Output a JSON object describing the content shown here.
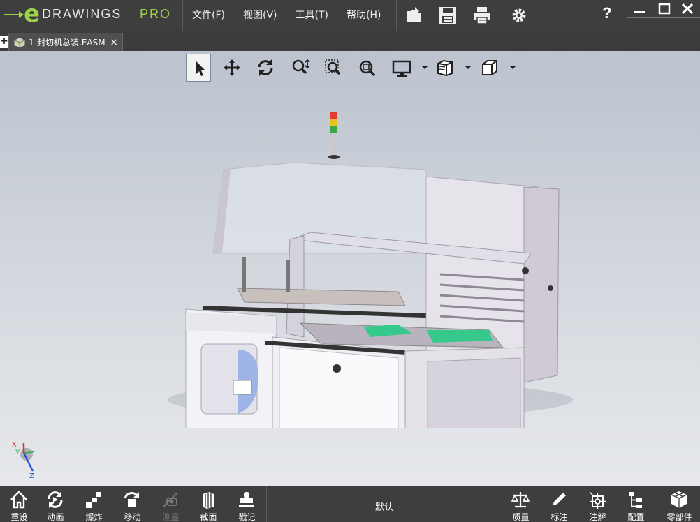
{
  "app": {
    "logo_e": "e",
    "logo_word": "DRAWINGS",
    "logo_pro": "PRO",
    "colors": {
      "accent": "#9bd24a",
      "toolbar_bg": "#3e3e3e",
      "viewport_top": "#bcc3ce",
      "viewport_bottom": "#e6e8eb"
    }
  },
  "menu": [
    {
      "label": "文件(F)"
    },
    {
      "label": "视图(V)"
    },
    {
      "label": "工具(T)"
    },
    {
      "label": "帮助(H)"
    }
  ],
  "toolbar_icons": [
    "open-icon",
    "save-icon",
    "print-icon",
    "settings-gear-icon"
  ],
  "help": {
    "label": "?"
  },
  "window_controls": [
    "minimize-icon",
    "maximize-icon",
    "close-icon"
  ],
  "tabs": {
    "add_label": "+",
    "document": {
      "label": "1-封切机总装.EASM",
      "close": "×"
    }
  },
  "view_tools": [
    "select-arrow-icon",
    "pan-icon",
    "rotate-icon",
    "zoom-icon",
    "zoom-to-area-icon",
    "zoom-to-fit-icon",
    "display-style-icon",
    "shaded-view-icon",
    "view-orientation-icon"
  ],
  "bottom_tools_left": [
    {
      "label": "重设",
      "icon": "home-icon",
      "enabled": true
    },
    {
      "label": "动画",
      "icon": "animate-icon",
      "enabled": true
    },
    {
      "label": "爆炸",
      "icon": "explode-icon",
      "enabled": true
    },
    {
      "label": "移动",
      "icon": "move-icon",
      "enabled": true
    },
    {
      "label": "测量",
      "icon": "measure-icon",
      "enabled": false
    },
    {
      "label": "截面",
      "icon": "section-icon",
      "enabled": true
    },
    {
      "label": "戳记",
      "icon": "stamp-icon",
      "enabled": true
    }
  ],
  "configuration": {
    "label": "默认"
  },
  "bottom_tools_right": [
    {
      "label": "质量",
      "icon": "mass-scale-icon"
    },
    {
      "label": "标注",
      "icon": "markup-pencil-icon"
    },
    {
      "label": "注解",
      "icon": "annotation-icon"
    },
    {
      "label": "配置",
      "icon": "configuration-icon"
    },
    {
      "label": "零部件",
      "icon": "components-icon"
    }
  ],
  "triad": {
    "x": "X",
    "y": "Y",
    "z": "Z"
  }
}
